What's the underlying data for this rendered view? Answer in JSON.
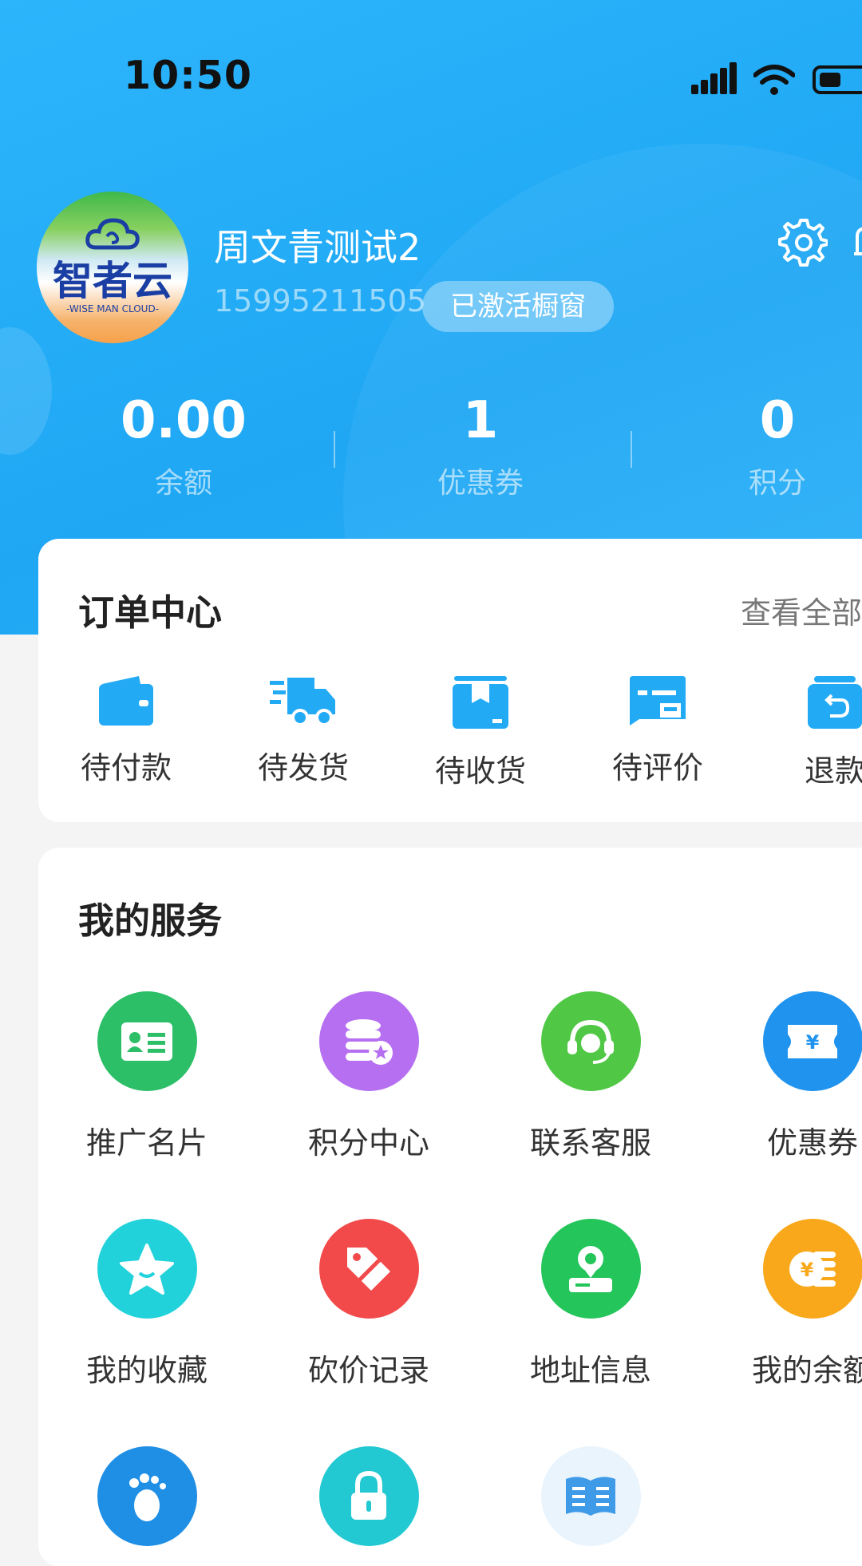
{
  "status_bar": {
    "time": "10:50"
  },
  "profile": {
    "avatar_logo_cn": "智者云",
    "avatar_logo_en": "-WISE MAN CLOUD-",
    "name": "周文青测试2",
    "phone": "15995211505",
    "badge": "已激活橱窗"
  },
  "stats": [
    {
      "value": "0.00",
      "label": "余额"
    },
    {
      "value": "1",
      "label": "优惠券"
    },
    {
      "value": "0",
      "label": "积分"
    }
  ],
  "orders": {
    "title": "订单中心",
    "view_all": "查看全部",
    "items": [
      {
        "label": "待付款",
        "icon": "wallet-icon"
      },
      {
        "label": "待发货",
        "icon": "truck-icon"
      },
      {
        "label": "待收货",
        "icon": "box-icon"
      },
      {
        "label": "待评价",
        "icon": "review-icon"
      },
      {
        "label": "退款",
        "icon": "refund-icon"
      }
    ]
  },
  "services": {
    "title": "我的服务",
    "items": [
      {
        "label": "推广名片",
        "icon": "business-card-icon",
        "color": "#2cbf68"
      },
      {
        "label": "积分中心",
        "icon": "points-coins-icon",
        "color": "#b56ff0"
      },
      {
        "label": "联系客服",
        "icon": "headset-icon",
        "color": "#50c845"
      },
      {
        "label": "优惠券",
        "icon": "coupon-ticket-icon",
        "color": "#1f93ee"
      },
      {
        "label": "我的收藏",
        "icon": "star-icon",
        "color": "#22d2da"
      },
      {
        "label": "砍价记录",
        "icon": "price-tag-icon",
        "color": "#f24a4a"
      },
      {
        "label": "地址信息",
        "icon": "location-icon",
        "color": "#24c55a"
      },
      {
        "label": "我的余额",
        "icon": "coin-icon",
        "color": "#f8a81a"
      },
      {
        "label": "",
        "icon": "footprint-icon",
        "color": "#1f8fe6"
      },
      {
        "label": "",
        "icon": "lock-icon",
        "color": "#22c8d2"
      },
      {
        "label": "",
        "icon": "book-icon",
        "color": "#eaf4fd"
      }
    ]
  },
  "colors": {
    "brand_blue": "#22aaf5",
    "icon_blue": "#22aaf5"
  }
}
